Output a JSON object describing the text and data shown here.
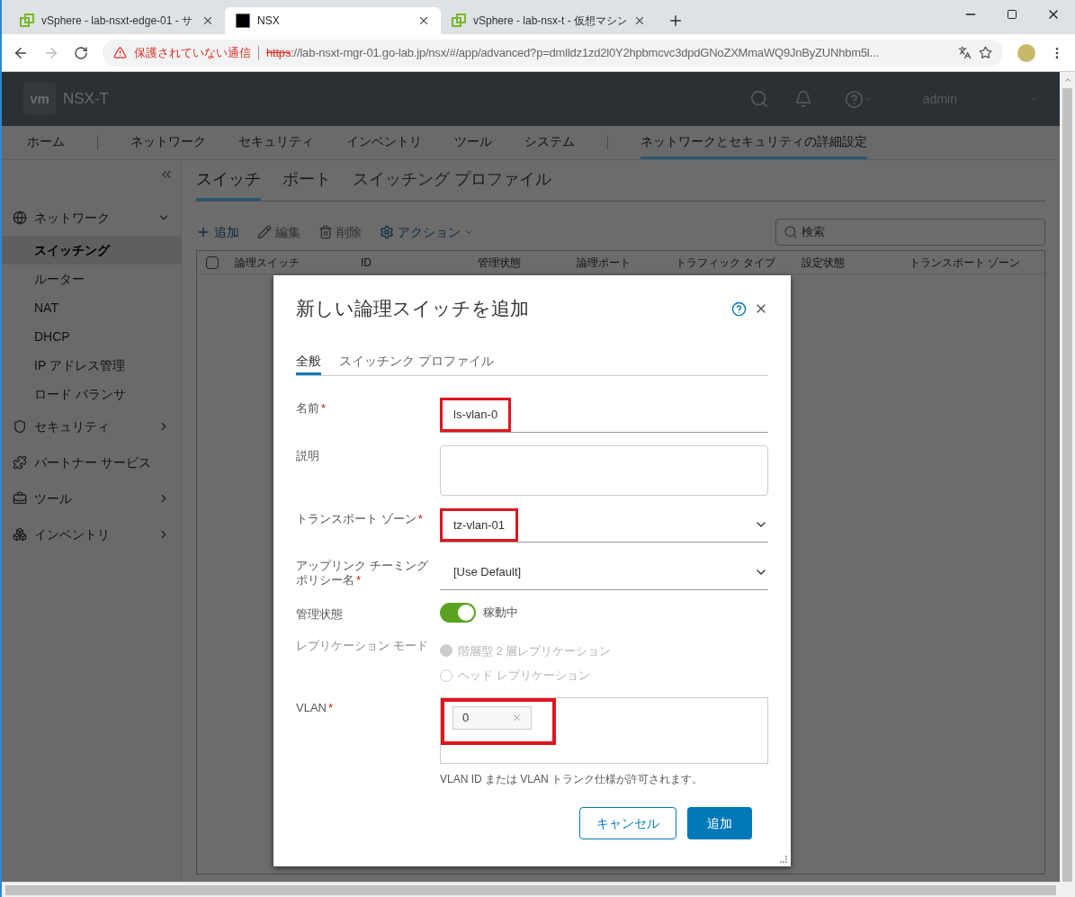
{
  "browser": {
    "tabs": [
      {
        "title": "vSphere - lab-nsxt-edge-01 - サ",
        "selected": false,
        "kind": "vsphere"
      },
      {
        "title": "NSX",
        "selected": true,
        "kind": "nsx"
      },
      {
        "title": "vSphere - lab-nsx-t - 仮想マシン",
        "selected": false,
        "kind": "vsphere"
      }
    ],
    "address": {
      "warning": "保護されていない通信",
      "scheme": "https",
      "rest": "://lab-nsxt-mgr-01.go-lab.jp/nsx/#/app/advanced?p=dmlldz1zd2l0Y2hpbmcvc3dpdGNoZXMmaWQ9JnByZUNhbm5l..."
    }
  },
  "app": {
    "logo": "vm",
    "product": "NSX-T",
    "user": "admin",
    "nav": [
      {
        "label": "ホーム",
        "selected": false
      },
      {
        "label": "ネットワーク",
        "selected": false
      },
      {
        "label": "セキュリティ",
        "selected": false
      },
      {
        "label": "インベントリ",
        "selected": false
      },
      {
        "label": "ツール",
        "selected": false
      },
      {
        "label": "システム",
        "selected": false
      },
      {
        "label": "ネットワークとセキュリティの詳細設定",
        "selected": true
      }
    ],
    "sidebar": {
      "groups": [
        {
          "label": "ネットワーク",
          "expanded": true,
          "children": [
            {
              "label": "スイッチング",
              "selected": true
            },
            {
              "label": "ルーター",
              "selected": false
            },
            {
              "label": "NAT",
              "selected": false
            },
            {
              "label": "DHCP",
              "selected": false
            },
            {
              "label": "IP アドレス管理",
              "selected": false
            },
            {
              "label": "ロード バランサ",
              "selected": false
            }
          ]
        },
        {
          "label": "セキュリティ",
          "expanded": false
        },
        {
          "label": "パートナー サービス"
        },
        {
          "label": "ツール",
          "expanded": false
        },
        {
          "label": "インベントリ",
          "expanded": false
        }
      ]
    },
    "subtabs": [
      {
        "label": "スイッチ",
        "selected": true
      },
      {
        "label": "ポート",
        "selected": false
      },
      {
        "label": "スイッチング プロファイル",
        "selected": false
      }
    ],
    "toolbar": [
      {
        "label": "追加",
        "disabled": false
      },
      {
        "label": "編集",
        "disabled": true
      },
      {
        "label": "削除",
        "disabled": true
      },
      {
        "label": "アクション",
        "disabled": false
      }
    ],
    "search": {
      "placeholder": "検索"
    },
    "table": {
      "select_all": {
        "checked": false
      },
      "columns": [
        "論理スイッチ",
        "ID",
        "管理状態",
        "論理ポート",
        "トラフィック タイプ",
        "設定状態",
        "トランスポート ゾーン"
      ]
    }
  },
  "dialog": {
    "title": "新しい論理スイッチを追加",
    "required_mark": "*",
    "tabs": [
      {
        "label": "全般",
        "selected": true
      },
      {
        "label": "スイッチンク プロファイル",
        "selected": false
      }
    ],
    "fields": [
      {
        "kind": "text",
        "label": "名前",
        "required": true,
        "value": "ls-vlan-0",
        "highlighted": true
      },
      {
        "kind": "textarea",
        "label": "説明"
      },
      {
        "kind": "select",
        "label": "トランスポート ゾーン",
        "required": true,
        "value": "tz-vlan-01",
        "highlighted": true
      },
      {
        "kind": "select",
        "label": "アップリンク チーミングポリシー名",
        "required": true,
        "value": "[Use Default]",
        "highlighted": false
      },
      {
        "kind": "toggle",
        "label": "管理状態",
        "on": true,
        "text": "稼動中"
      },
      {
        "kind": "radio",
        "label": "レプリケーション モード",
        "disabled": true,
        "options": [
          {
            "label": "階層型 2 層レプリケーション",
            "selected": true
          },
          {
            "label": "ヘッド レプリケーション",
            "selected": false
          }
        ]
      },
      {
        "kind": "tags",
        "label": "VLAN",
        "required": true,
        "tags": [
          "0"
        ],
        "highlighted": true,
        "hint": "VLAN ID または VLAN トランク仕様が許可されます。"
      }
    ],
    "buttons": [
      {
        "label": "キャンセル",
        "kind": "secondary"
      },
      {
        "label": "追加",
        "kind": "primary"
      }
    ]
  }
}
